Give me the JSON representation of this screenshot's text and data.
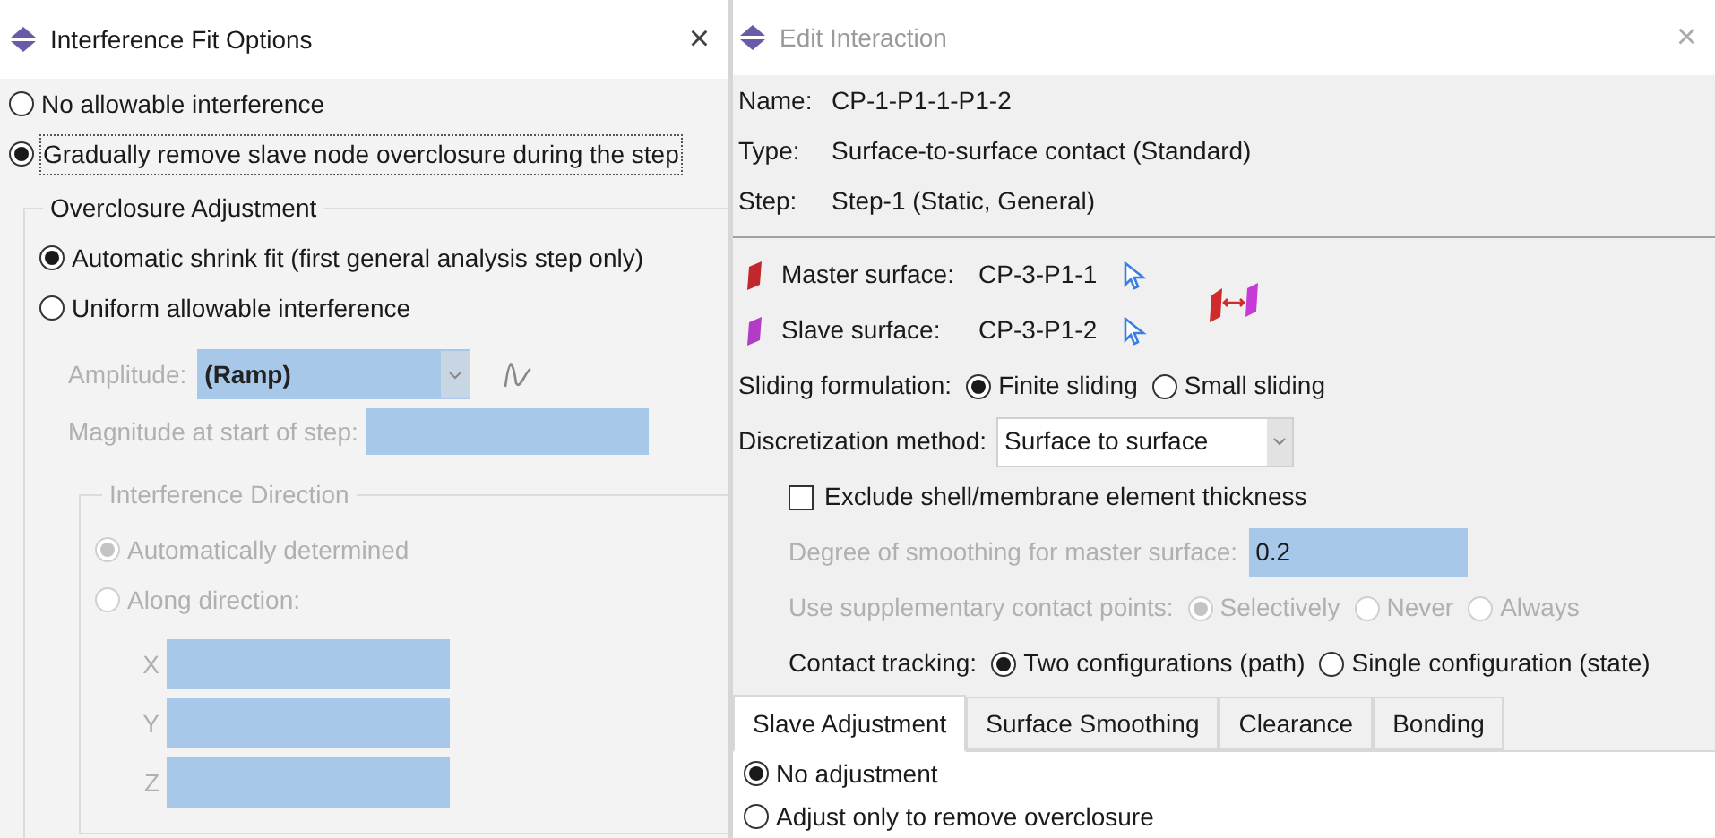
{
  "interference_fit_dialog": {
    "title": "Interference Fit Options",
    "close": "×",
    "options": [
      {
        "label": "No allowable interference",
        "selected": false
      },
      {
        "label": "Gradually remove slave node overclosure during the step",
        "selected": true
      }
    ],
    "overclosure_adjustment": {
      "title": "Overclosure Adjustment",
      "options": [
        {
          "label": "Automatic shrink fit (first general analysis step only)",
          "selected": true
        },
        {
          "label": "Uniform allowable interference",
          "selected": false
        }
      ],
      "amplitude": {
        "label": "Amplitude:",
        "value": "(Ramp)",
        "disabled": true
      },
      "magnitude": {
        "label": "Magnitude at start of step:",
        "disabled": true
      },
      "interference_direction": {
        "title": "Interference Direction",
        "disabled": true,
        "options": [
          {
            "label": "Automatically determined",
            "selected": true
          },
          {
            "label": "Along direction:",
            "selected": false
          }
        ],
        "components": [
          {
            "label": "X"
          },
          {
            "label": "Y"
          },
          {
            "label": "Z"
          }
        ]
      }
    }
  },
  "edit_interaction_dialog": {
    "title": "Edit Interaction",
    "close": "×",
    "fields": [
      {
        "label": "Name:",
        "value": "CP-1-P1-1-P1-2"
      },
      {
        "label": "Type:",
        "value": "Surface-to-surface contact (Standard)"
      },
      {
        "label": "Step:",
        "value": "Step-1 (Static, General)"
      }
    ],
    "surfaces": [
      {
        "label": "Master surface:",
        "value": "CP-3-P1-1",
        "color": "#c0282d"
      },
      {
        "label": "Slave surface:",
        "value": "CP-3-P1-2",
        "color": "#b23cc8"
      }
    ],
    "sliding_formulation": {
      "label": "Sliding formulation:",
      "options": [
        {
          "label": "Finite sliding",
          "selected": true
        },
        {
          "label": "Small sliding",
          "selected": false
        }
      ]
    },
    "discretization_method": {
      "label": "Discretization method:",
      "value": "Surface to surface"
    },
    "exclude_thickness": {
      "label": "Exclude shell/membrane element thickness",
      "checked": false
    },
    "smoothing_degree": {
      "label": "Degree of smoothing for master surface:",
      "value": "0.2",
      "disabled": true
    },
    "supplementary_points": {
      "label": "Use supplementary contact points:",
      "disabled": true,
      "options": [
        {
          "label": "Selectively",
          "selected": true
        },
        {
          "label": "Never",
          "selected": false
        },
        {
          "label": "Always",
          "selected": false
        }
      ]
    },
    "contact_tracking": {
      "label": "Contact tracking:",
      "options": [
        {
          "label": "Two configurations (path)",
          "selected": true
        },
        {
          "label": "Single configuration (state)",
          "selected": false
        }
      ]
    },
    "tabs": [
      {
        "label": "Slave Adjustment",
        "selected": true
      },
      {
        "label": "Surface Smoothing",
        "selected": false
      },
      {
        "label": "Clearance",
        "selected": false
      },
      {
        "label": "Bonding",
        "selected": false
      }
    ],
    "slave_adjustment": {
      "options": [
        {
          "label": "No adjustment",
          "selected": true
        },
        {
          "label": "Adjust only to remove overclosure",
          "selected": false
        }
      ]
    }
  }
}
